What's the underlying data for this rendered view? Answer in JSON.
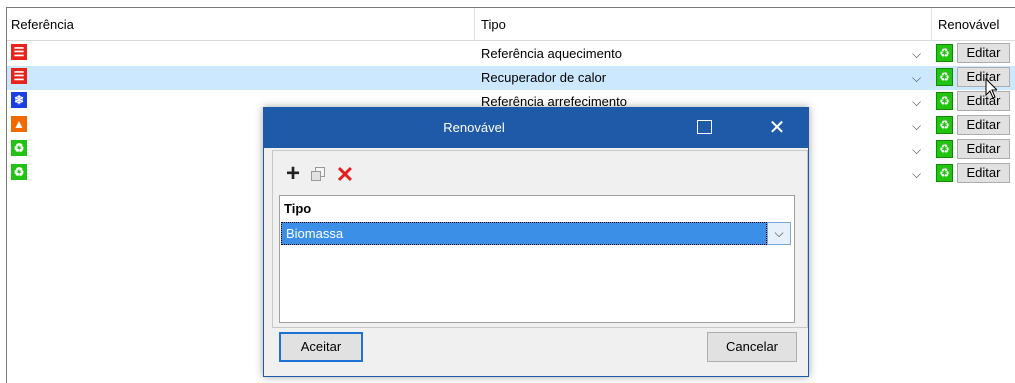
{
  "grid": {
    "columns": [
      "Referência",
      "Tipo",
      "Renovável"
    ],
    "rows": [
      {
        "ref_icon": "radiator-icon",
        "tipo": "Referência aquecimento",
        "edit": "Editar",
        "selected": false
      },
      {
        "ref_icon": "radiator-icon",
        "tipo": "Recuperador de calor",
        "edit": "Editar",
        "selected": true
      },
      {
        "ref_icon": "snowflake-icon",
        "tipo": "Referência arrefecimento",
        "edit": "Editar",
        "selected": false
      },
      {
        "ref_icon": "water-heater-icon",
        "tipo": "",
        "edit": "Editar",
        "selected": false
      },
      {
        "ref_icon": "recycle-icon",
        "tipo": "",
        "edit": "Editar",
        "selected": false
      },
      {
        "ref_icon": "recycle-icon",
        "tipo": "",
        "edit": "Editar",
        "selected": false
      }
    ]
  },
  "dialog": {
    "title": "Renovável",
    "table": {
      "header": "Tipo",
      "rows": [
        "Biomassa"
      ]
    },
    "accept_label": "Aceitar",
    "cancel_label": "Cancelar"
  },
  "colors": {
    "accent": "#1e5aa8",
    "selection": "#cce8ff",
    "renewable_green": "#22c414"
  }
}
